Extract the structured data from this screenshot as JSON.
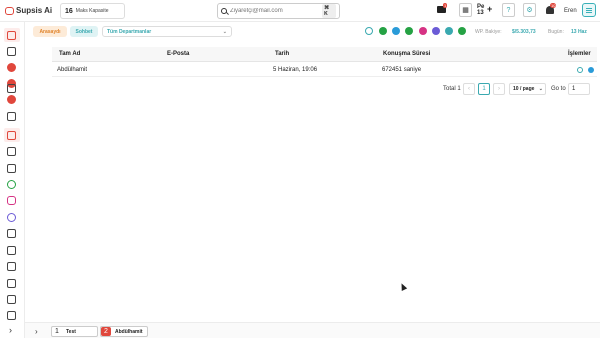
{
  "brand": {
    "name": "Supsis Ai"
  },
  "header": {
    "capacity_count": "16",
    "capacity_label": "Maks Kapasite",
    "search_placeholder": "Ziyaretçi@mail.com",
    "search_shortcut": "⌘ K",
    "mail_badge": "1",
    "pe_line1": "Pe",
    "pe_line2": "13",
    "pe_plus": "+",
    "help_glyph": "?",
    "bell_badge": "10",
    "user_name": "Eren"
  },
  "filters": {
    "tab_active": "Arasaydı",
    "tab_chat": "Sohbet",
    "department": "Tüm Departmanlar",
    "wp_balance_label": "WP. Bakiye:",
    "wp_balance_value": "$/5.303,73",
    "today_label": "Bugün:",
    "today_value": "13 Haz"
  },
  "table": {
    "columns": [
      "Tam Ad",
      "E-Posta",
      "Tarih",
      "Konuşma Süresi",
      "İşlemler"
    ],
    "rows": [
      {
        "name": "Abdülhamit",
        "email": "",
        "date": "5 Haziran, 19:06",
        "duration": "672451 saniye"
      }
    ]
  },
  "pagination": {
    "total": "Total 1",
    "prev": "‹",
    "current_page": "1",
    "next": "›",
    "page_size": "10 / page",
    "goto_label": "Go to",
    "goto_value": "1"
  },
  "bottom_tabs": [
    {
      "num": "1",
      "label": "Test"
    },
    {
      "num": "2",
      "label": "Abdülhamit"
    }
  ],
  "colors": {
    "accent": "#3aa9b0",
    "brand": "#e0473c",
    "orange": "#e0832a"
  }
}
